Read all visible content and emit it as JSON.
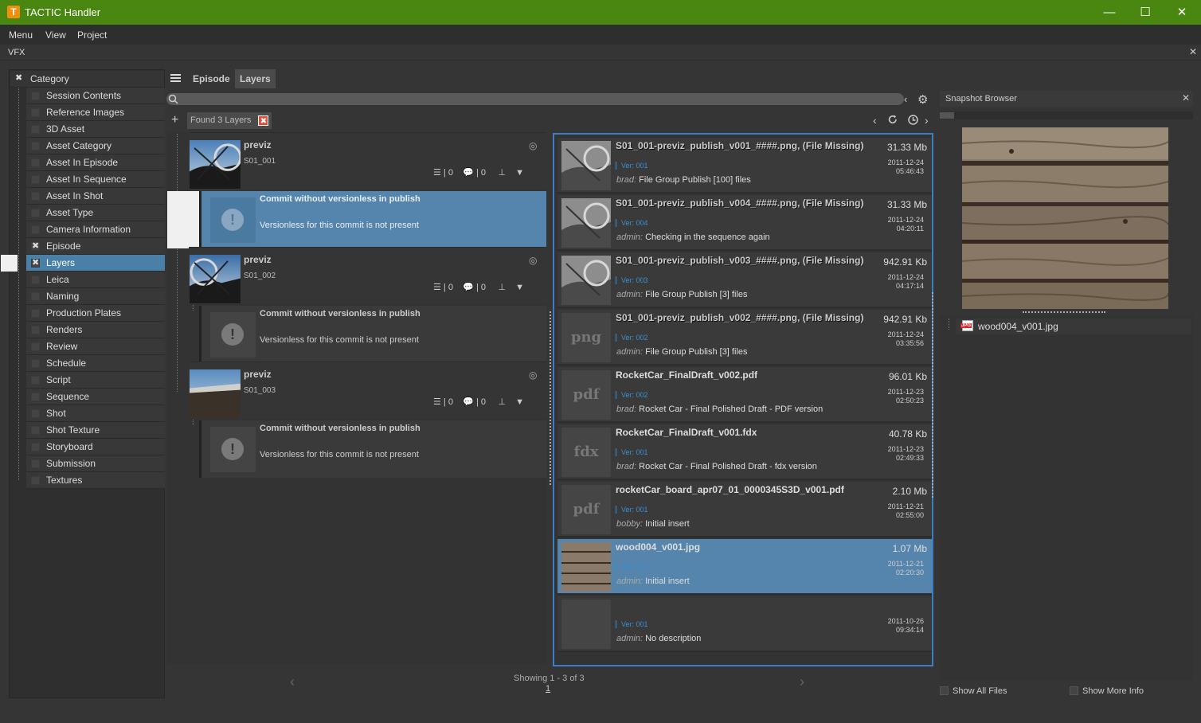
{
  "window": {
    "title": "TACTIC Handler",
    "minimize": "—",
    "maximize": "☐",
    "close": "✕"
  },
  "menu": [
    "Menu",
    "View",
    "Project"
  ],
  "project_tab": {
    "label": "VFX",
    "close": "✕"
  },
  "category": {
    "header": "Category",
    "items": [
      "Session Contents",
      "Reference Images",
      "3D Asset",
      "Asset Category",
      "Asset In Episode",
      "Asset In Sequence",
      "Asset In Shot",
      "Asset Type",
      "Camera Information",
      "Episode",
      "Layers",
      "Leica",
      "Naming",
      "Production Plates",
      "Renders",
      "Review",
      "Schedule",
      "Script",
      "Sequence",
      "Shot",
      "Shot Texture",
      "Storyboard",
      "Submission",
      "Textures"
    ]
  },
  "tabs": [
    "Episode",
    "Layers"
  ],
  "found_tag": "Found 3 Layers",
  "layers": [
    {
      "name": "previz",
      "code": "S01_001",
      "tasks": "0",
      "notes": "0"
    },
    {
      "name": "previz",
      "code": "S01_002",
      "tasks": "0",
      "notes": "0"
    },
    {
      "name": "previz",
      "code": "S01_003",
      "tasks": "0",
      "notes": "0"
    }
  ],
  "commit": {
    "title": "Commit without versionless in publish",
    "desc": "Versionless for this commit is not present"
  },
  "snapshots": [
    {
      "thumb": "",
      "file": "S01_001-previz_publish_v001_####.png, (File Missing)",
      "size": "31.33 Mb",
      "ver": "Ver: 001",
      "date": "2011-12-24",
      "time": "05:46:43",
      "user": "brad:",
      "note": "File Group Publish [100] files"
    },
    {
      "thumb": "",
      "file": "S01_001-previz_publish_v004_####.png, (File Missing)",
      "size": "31.33 Mb",
      "ver": "Ver: 004",
      "date": "2011-12-24",
      "time": "04:20:11",
      "user": "admin:",
      "note": "Checking in the sequence again"
    },
    {
      "thumb": "",
      "file": "S01_001-previz_publish_v003_####.png, (File Missing)",
      "size": "942.91 Kb",
      "ver": "Ver: 003",
      "date": "2011-12-24",
      "time": "04:17:14",
      "user": "admin:",
      "note": "File Group Publish [3] files"
    },
    {
      "thumb": "png",
      "file": "S01_001-previz_publish_v002_####.png, (File Missing)",
      "size": "942.91 Kb",
      "ver": "Ver: 002",
      "date": "2011-12-24",
      "time": "03:35:56",
      "user": "admin:",
      "note": "File Group Publish [3] files"
    },
    {
      "thumb": "pdf",
      "file": "RocketCar_FinalDraft_v002.pdf",
      "size": "96.01 Kb",
      "ver": "Ver: 002",
      "date": "2011-12-23",
      "time": "02:50:23",
      "user": "brad:",
      "note": "Rocket Car - Final Polished Draft - PDF version"
    },
    {
      "thumb": "fdx",
      "file": "RocketCar_FinalDraft_v001.fdx",
      "size": "40.78 Kb",
      "ver": "Ver: 001",
      "date": "2011-12-23",
      "time": "02:49:33",
      "user": "brad:",
      "note": "Rocket Car - Final Polished Draft - fdx version"
    },
    {
      "thumb": "pdf",
      "file": "rocketCar_board_apr07_01_0000345S3D_v001.pdf",
      "size": "2.10 Mb",
      "ver": "Ver: 001",
      "date": "2011-12-21",
      "time": "02:55:00",
      "user": "bobby:",
      "note": "Initial insert"
    },
    {
      "thumb": "",
      "file": "wood004_v001.jpg",
      "size": "1.07 Mb",
      "ver": "Ver: 001",
      "date": "2011-12-21",
      "time": "02:20:30",
      "user": "admin:",
      "note": "Initial insert"
    },
    {
      "thumb": "",
      "file": "",
      "size": "",
      "ver": "Ver: 001",
      "date": "2011-10-26",
      "time": "09:34:14",
      "user": "admin:",
      "note": "No description"
    }
  ],
  "paging": {
    "showing": "Showing 1 - 3 of 3",
    "page": "1"
  },
  "snapshot_browser": {
    "title": "Snapshot Browser",
    "close": "✕",
    "file": "wood004_v001.jpg",
    "file_badge": "JPG"
  },
  "options": {
    "show_all_files": "Show All Files",
    "show_more_info": "Show More Info"
  }
}
